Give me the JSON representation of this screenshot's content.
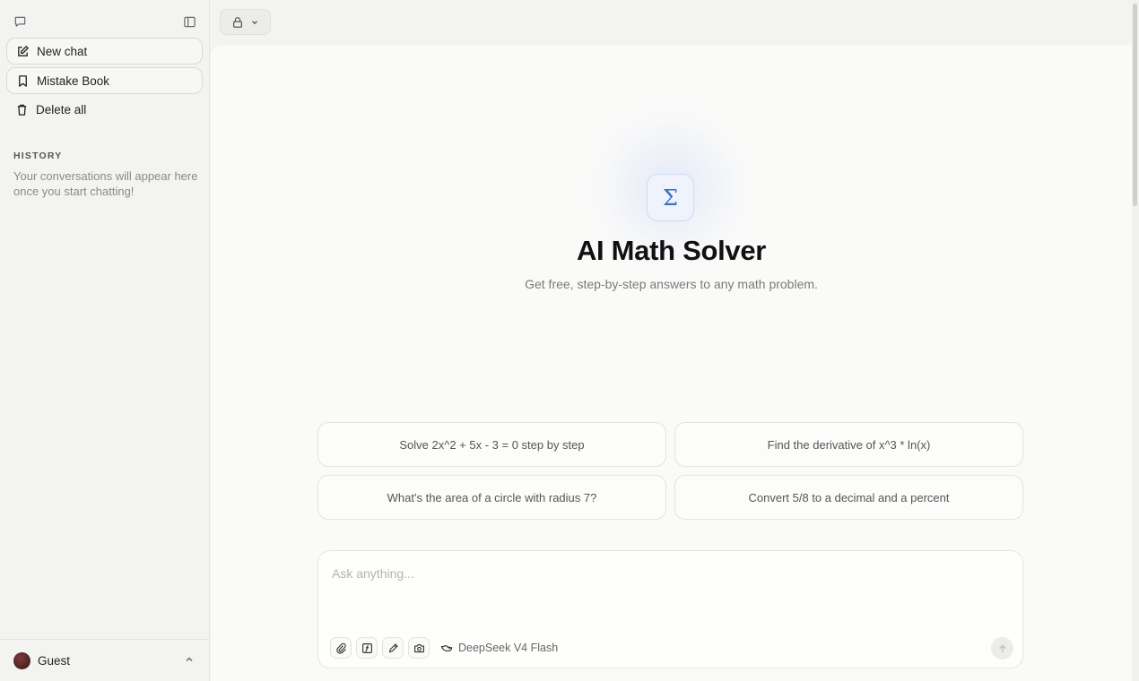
{
  "sidebar": {
    "new_chat_label": "New chat",
    "mistake_book_label": "Mistake Book",
    "delete_all_label": "Delete all",
    "history_heading": "HISTORY",
    "history_empty": "Your conversations will appear here once you start chatting!",
    "user_name": "Guest"
  },
  "hero": {
    "icon": "Σ",
    "title": "AI Math Solver",
    "subtitle": "Get free, step-by-step answers to any math problem."
  },
  "suggestions": [
    "Solve 2x^2 + 5x - 3 = 0 step by step",
    "Find the derivative of x^3 * ln(x)",
    "What's the area of a circle with radius 7?",
    "Convert 5/8 to a decimal and a percent"
  ],
  "composer": {
    "placeholder": "Ask anything...",
    "value": "",
    "model_label": "DeepSeek V4 Flash"
  },
  "icons": {
    "sidebar_chat": "chat-bubble-icon",
    "sidebar_toggle": "sidebar-toggle-icon",
    "new_chat": "edit-icon",
    "mistake_book": "bookmark-icon",
    "delete_all": "trash-icon",
    "lock": "lock-icon",
    "attach": "paperclip-icon",
    "formula": "formula-icon",
    "draw": "pencil-icon",
    "camera": "camera-icon",
    "model": "deepseek-whale-icon",
    "send": "arrow-up-icon"
  },
  "colors": {
    "accent": "#3d6fc6",
    "badge_bg": "#eef3fc"
  }
}
